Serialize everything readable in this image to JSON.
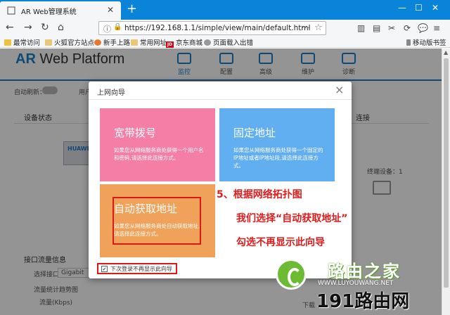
{
  "browser": {
    "tab_title": "AR Web管理系统",
    "url": "https://192.168.1.1/simple/view/main/default.html",
    "bookmarks": [
      "最常访问",
      "火狐官方站点",
      "新手上路",
      "常用网址",
      "京东商城",
      "页面载入出错"
    ],
    "mobile_bookmarks": "移动版书签",
    "jd_badge": "JD"
  },
  "app": {
    "logo_prefix": "AR",
    "logo_rest": " Web Platform",
    "nav": [
      "监控",
      "配置",
      "高级",
      "维护",
      "诊断"
    ],
    "active_nav": "监控",
    "auto_refresh_label": "自动刷新：",
    "user_label": "用户",
    "device_status": "设备状态",
    "connect_label": "连接",
    "device_model": "HUAWEI",
    "terminal_label": "终端设备：1",
    "iface_flow": "接口流量信息",
    "select_iface_label": "选择接口：",
    "select_iface_value": "Gigabit",
    "flow_chart_label": "流量统计趋势图",
    "flow_unit_label": "流量(Kbps)",
    "download_label": "下载"
  },
  "modal": {
    "title": "上网向导",
    "close": "×",
    "cards": [
      {
        "title": "宽带拨号",
        "desc": "如果您从网络服务商处获得一个用户名和密码,请选择此连接方式。",
        "color": "#f47ea6"
      },
      {
        "title": "固定地址",
        "desc": "如果您从网络服务商处获得一个固定的IP地址或者IP地址段,请选择此连接方式。",
        "color": "#61aef0"
      },
      {
        "title": "自动获取地址",
        "desc": "如果您从网络服务商处自动获取地址,请选择此连接方式。",
        "color": "#f0a15a"
      }
    ],
    "checkbox_label": "下次登录不再显示此向导",
    "checkbox_checked": true
  },
  "annotations": [
    "5、根据网络拓扑图",
    "我们选择“自动获取地址”",
    "勾选不再显示此向导"
  ],
  "watermark": {
    "brand": "路由之家",
    "url": "WWW.LUYOUWANG.NET",
    "site": "191路由网"
  },
  "colors": {
    "accent": "#1c7fc9",
    "highlight": "#e01818",
    "tabbar": "#0a84d8"
  }
}
